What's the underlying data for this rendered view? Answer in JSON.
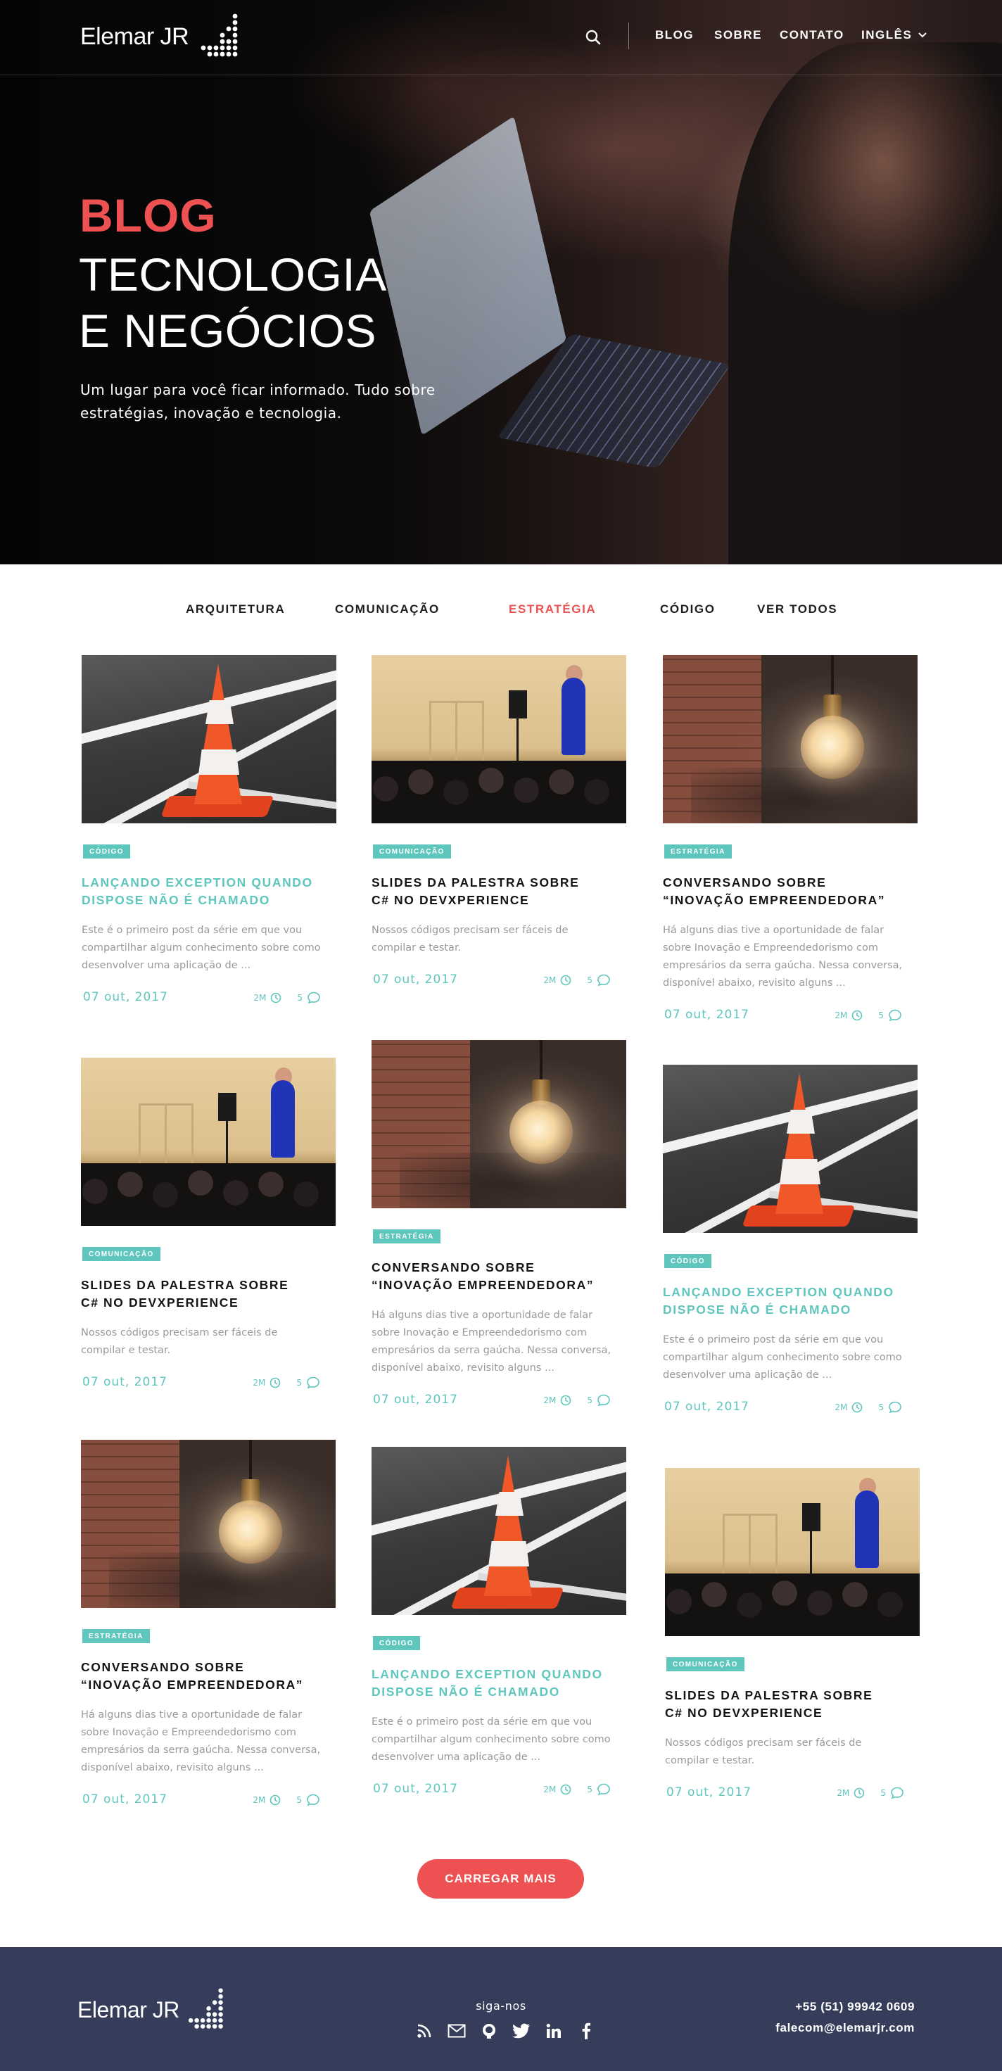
{
  "brand": {
    "name": "Elemar JR"
  },
  "nav": {
    "items": [
      "BLOG",
      "SOBRE",
      "CONTATO"
    ],
    "language": "INGLÊS"
  },
  "hero": {
    "kicker": "BLOG",
    "title_line1": "TECNOLOGIA",
    "title_line2": "E NEGÓCIOS",
    "subtitle": "Um lugar para você ficar informado. Tudo sobre estratégias, inovação e tecnologia."
  },
  "categories": {
    "items": [
      "ARQUITETURA",
      "COMUNICAÇÃO",
      "ESTRATÉGIA",
      "CÓDIGO",
      "VER TODOS"
    ],
    "active": "ESTRATÉGIA"
  },
  "posts": [
    {
      "image": "traffic-cone",
      "tag": "CÓDIGO",
      "title": "LANÇANDO EXCEPTION QUANDO\nDISPOSE NÃO É CHAMADO",
      "excerpt": "Este é o primeiro post da série em que vou compartilhar algum conhecimento sobre como desenvolver uma aplicação de ...",
      "date": "07 out, 2017",
      "time": "2M",
      "comments": "5"
    },
    {
      "image": "conference-stage",
      "tag": "COMUNICAÇÃO",
      "title": "SLIDES DA PALESTRA SOBRE\nC# NO DEVXPERIENCE",
      "excerpt": "Nossos códigos precisam ser fáceis de compilar e testar.",
      "date": "07 out, 2017",
      "time": "2M",
      "comments": "5"
    },
    {
      "image": "light-bulb",
      "tag": "ESTRATÉGIA",
      "title": "CONVERSANDO SOBRE\n“INOVAÇÃO EMPREENDEDORA”",
      "excerpt": "Há alguns dias tive a oportunidade de falar sobre Inovação e Empreendedorismo com empresários da serra gaúcha. Nessa conversa, disponível abaixo, revisito alguns ...",
      "date": "07 out, 2017",
      "time": "2M",
      "comments": "5"
    },
    {
      "image": "conference-stage",
      "tag": "COMUNICAÇÃO",
      "title": "SLIDES DA PALESTRA SOBRE\nC# NO DEVXPERIENCE",
      "excerpt": "Nossos códigos precisam ser fáceis de compilar e testar.",
      "date": "07 out, 2017",
      "time": "2M",
      "comments": "5"
    },
    {
      "image": "light-bulb",
      "tag": "ESTRATÉGIA",
      "title": "CONVERSANDO SOBRE\n“INOVAÇÃO EMPREENDEDORA”",
      "excerpt": "Há alguns dias tive a oportunidade de falar sobre Inovação e Empreendedorismo com empresários da serra gaúcha. Nessa conversa, disponível abaixo, revisito alguns ...",
      "date": "07 out, 2017",
      "time": "2M",
      "comments": "5"
    },
    {
      "image": "traffic-cone",
      "tag": "CÓDIGO",
      "title": "LANÇANDO EXCEPTION QUANDO\nDISPOSE NÃO É CHAMADO",
      "excerpt": "Este é o primeiro post da série em que vou compartilhar algum conhecimento sobre como desenvolver uma aplicação de ...",
      "date": "07 out, 2017",
      "time": "2M",
      "comments": "5"
    },
    {
      "image": "light-bulb",
      "tag": "ESTRATÉGIA",
      "title": "CONVERSANDO SOBRE\n“INOVAÇÃO EMPREENDEDORA”",
      "excerpt": "Há alguns dias tive a oportunidade de falar sobre Inovação e Empreendedorismo com empresários da serra gaúcha. Nessa conversa, disponível abaixo, revisito alguns ...",
      "date": "07 out, 2017",
      "time": "2M",
      "comments": "5"
    },
    {
      "image": "traffic-cone",
      "tag": "CÓDIGO",
      "title": "LANÇANDO EXCEPTION QUANDO\nDISPOSE NÃO É CHAMADO",
      "excerpt": "Este é o primeiro post da série em que vou compartilhar algum conhecimento sobre como desenvolver uma aplicação de ...",
      "date": "07 out, 2017",
      "time": "2M",
      "comments": "5"
    },
    {
      "image": "conference-stage",
      "tag": "COMUNICAÇÃO",
      "title": "SLIDES DA PALESTRA SOBRE\nC# NO DEVXPERIENCE",
      "excerpt": "Nossos códigos precisam ser fáceis de compilar e testar.",
      "date": "07 out, 2017",
      "time": "2M",
      "comments": "5"
    }
  ],
  "load_more": "CARREGAR MAIS",
  "footer": {
    "brand": "Elemar JR",
    "follow_label": "siga-nos",
    "social_icons": [
      "rss-icon",
      "mail-icon",
      "github-icon",
      "twitter-icon",
      "linkedin-icon",
      "facebook-icon"
    ],
    "phone": "+55 (51) 99942 0609",
    "email": "falecom@elemarjr.com"
  },
  "colors": {
    "accent_red": "#ed5152",
    "accent_teal": "#5ec6bd",
    "footer_bg": "#363d5a",
    "hero_bg": "#111010"
  }
}
